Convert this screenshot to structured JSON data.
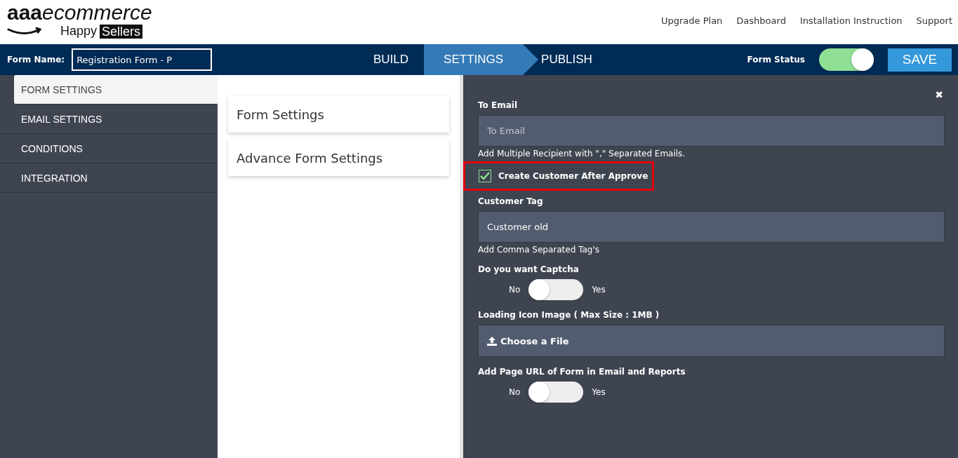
{
  "logo": {
    "brand_bold": "aaa",
    "brand_italic": "ecommerce",
    "tagline_1": "Happy",
    "tagline_2": "Sellers"
  },
  "top_links": [
    "Upgrade Plan",
    "Dashboard",
    "Installation Instruction",
    "Support"
  ],
  "toolbar": {
    "form_name_label": "Form Name:",
    "form_name_value": "Registration Form - P",
    "tabs": [
      {
        "label": "BUILD",
        "selected": false
      },
      {
        "label": "SETTINGS",
        "selected": true
      },
      {
        "label": "PUBLISH",
        "selected": false
      }
    ],
    "form_status_label": "Form Status",
    "form_status_on": true,
    "save_label": "SAVE"
  },
  "sidebar": {
    "items": [
      {
        "label": "FORM SETTINGS",
        "selected": true
      },
      {
        "label": "EMAIL SETTINGS",
        "selected": false
      },
      {
        "label": "CONDITIONS",
        "selected": false
      },
      {
        "label": "INTEGRATION",
        "selected": false
      }
    ]
  },
  "sections": [
    {
      "label": "Form Settings"
    },
    {
      "label": "Advance Form Settings"
    }
  ],
  "panel": {
    "close": "✖",
    "fields": [
      {
        "kind": "input",
        "label": "To Email",
        "placeholder": "To Email",
        "help": "Add Multiple Recipient with \",\" Separated Emails."
      },
      {
        "kind": "checkbox",
        "label": "Create Customer After Approve",
        "checked": true,
        "highlighted": true
      },
      {
        "kind": "input",
        "label": "Customer Tag",
        "value": "Customer old",
        "help": "Add Comma Separated Tag's"
      },
      {
        "kind": "toggle",
        "label": "Do you want Captcha",
        "off_label": "No",
        "on_label": "Yes",
        "on": false
      },
      {
        "kind": "file",
        "label": "Loading Icon Image ( Max Size : 1MB )",
        "button": "Choose a File"
      },
      {
        "kind": "toggle",
        "label": "Add Page URL of Form in Email and Reports",
        "off_label": "No",
        "on_label": "Yes",
        "on": false
      }
    ]
  }
}
